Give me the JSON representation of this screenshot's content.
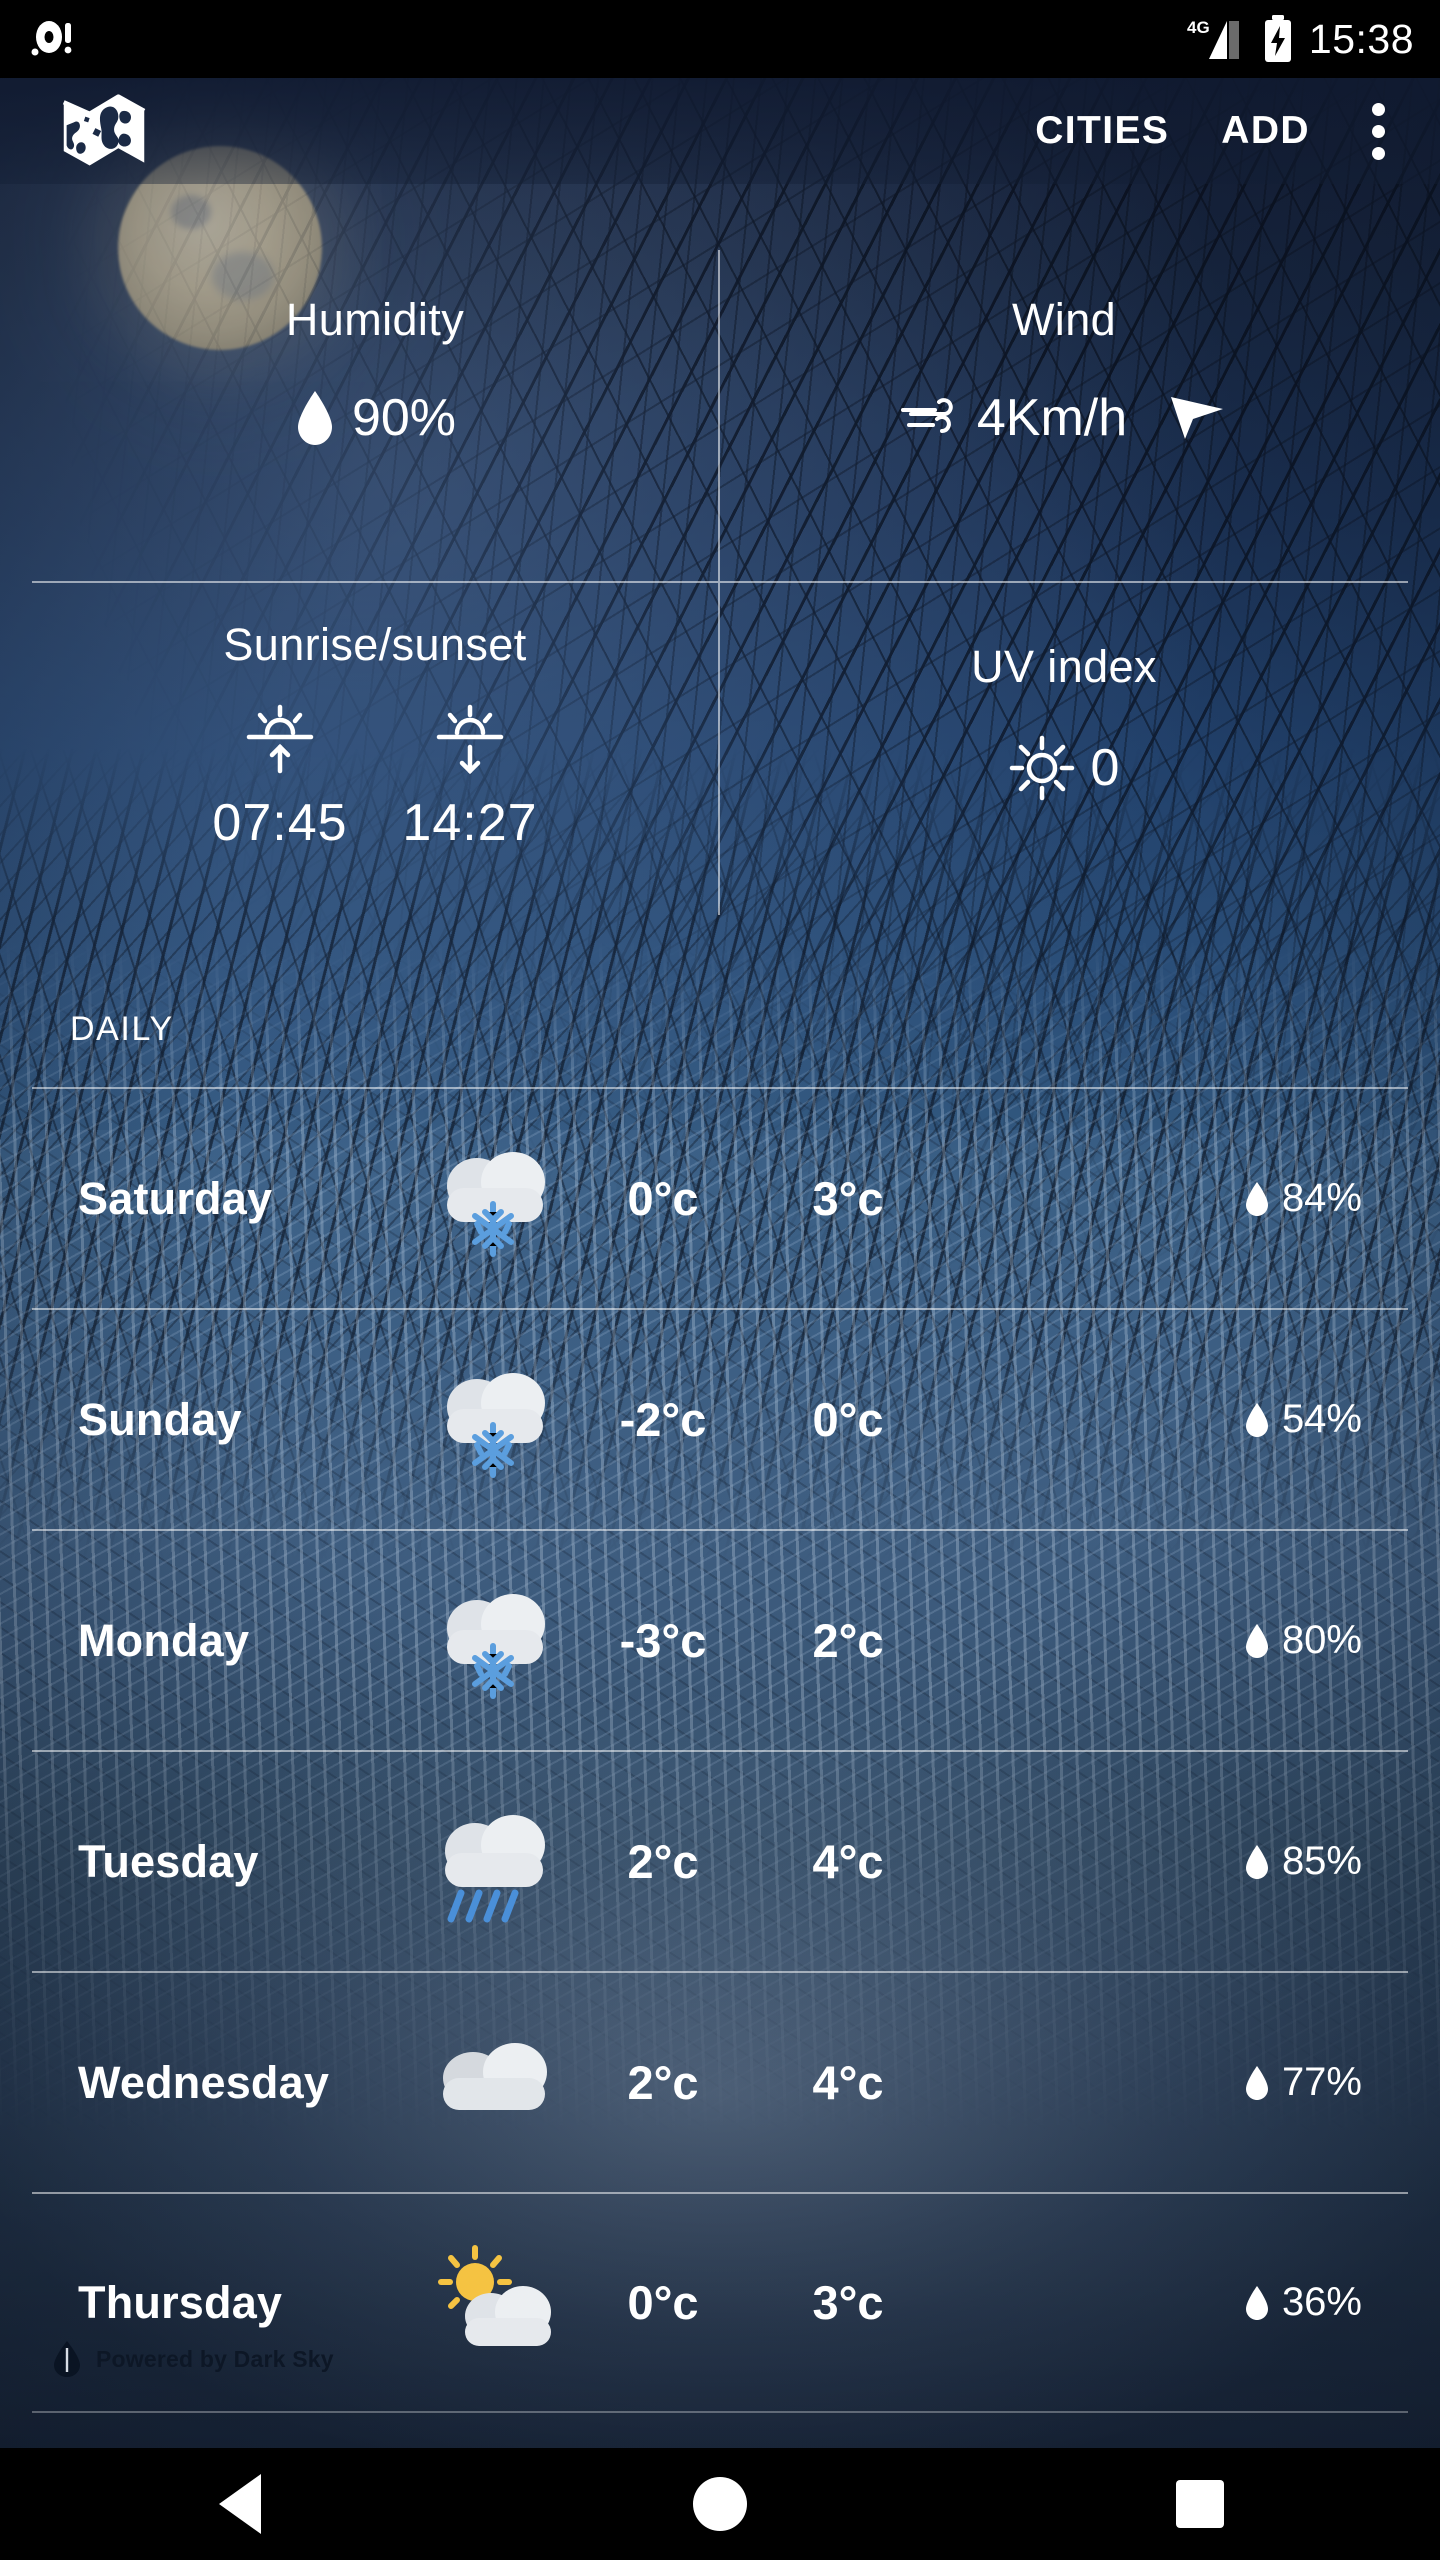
{
  "status_bar": {
    "notification_icon": "record-notification-icon",
    "network_label": "4G",
    "signal_icon": "signal-bars-icon",
    "battery_icon": "battery-charging-icon",
    "clock": "15:38"
  },
  "app_bar": {
    "logo_icon": "folded-map-icon",
    "cities_label": "CITIES",
    "add_label": "ADD",
    "overflow_icon": "overflow-menu-icon"
  },
  "details": {
    "humidity": {
      "title": "Humidity",
      "icon": "water-drop-icon",
      "value": "90%"
    },
    "wind": {
      "title": "Wind",
      "icon": "wind-icon",
      "value": "4Km/h",
      "direction_icon": "wind-direction-arrow-icon"
    },
    "sunrise_sunset": {
      "title": "Sunrise/sunset",
      "sunrise_icon": "sunrise-icon",
      "sunrise_time": "07:45",
      "sunset_icon": "sunset-icon",
      "sunset_time": "14:27"
    },
    "uv_index": {
      "title": "UV index",
      "icon": "sun-icon",
      "value": "0"
    }
  },
  "daily": {
    "label": "DAILY",
    "rows": [
      {
        "day": "Saturday",
        "condition": "snow",
        "low": "0°c",
        "high": "3°c",
        "precip": "84%"
      },
      {
        "day": "Sunday",
        "condition": "snow",
        "low": "-2°c",
        "high": "0°c",
        "precip": "54%"
      },
      {
        "day": "Monday",
        "condition": "snow",
        "low": "-3°c",
        "high": "2°c",
        "precip": "80%"
      },
      {
        "day": "Tuesday",
        "condition": "rain",
        "low": "2°c",
        "high": "4°c",
        "precip": "85%"
      },
      {
        "day": "Wednesday",
        "condition": "cloudy",
        "low": "2°c",
        "high": "4°c",
        "precip": "77%"
      },
      {
        "day": "Thursday",
        "condition": "partly-sunny",
        "low": "0°c",
        "high": "3°c",
        "precip": "36%"
      }
    ]
  },
  "footer": {
    "icon": "dark-sky-drop-icon",
    "text": "Powered by Dark Sky"
  },
  "nav_bar": {
    "back": "back-button",
    "home": "home-button",
    "recents": "recents-button"
  },
  "colors": {
    "accent_snow": "#5b9ede",
    "accent_rain": "#4a8fd8",
    "cloud": "#e2e6ea",
    "sun": "#f5c342",
    "text": "#ffffff"
  }
}
